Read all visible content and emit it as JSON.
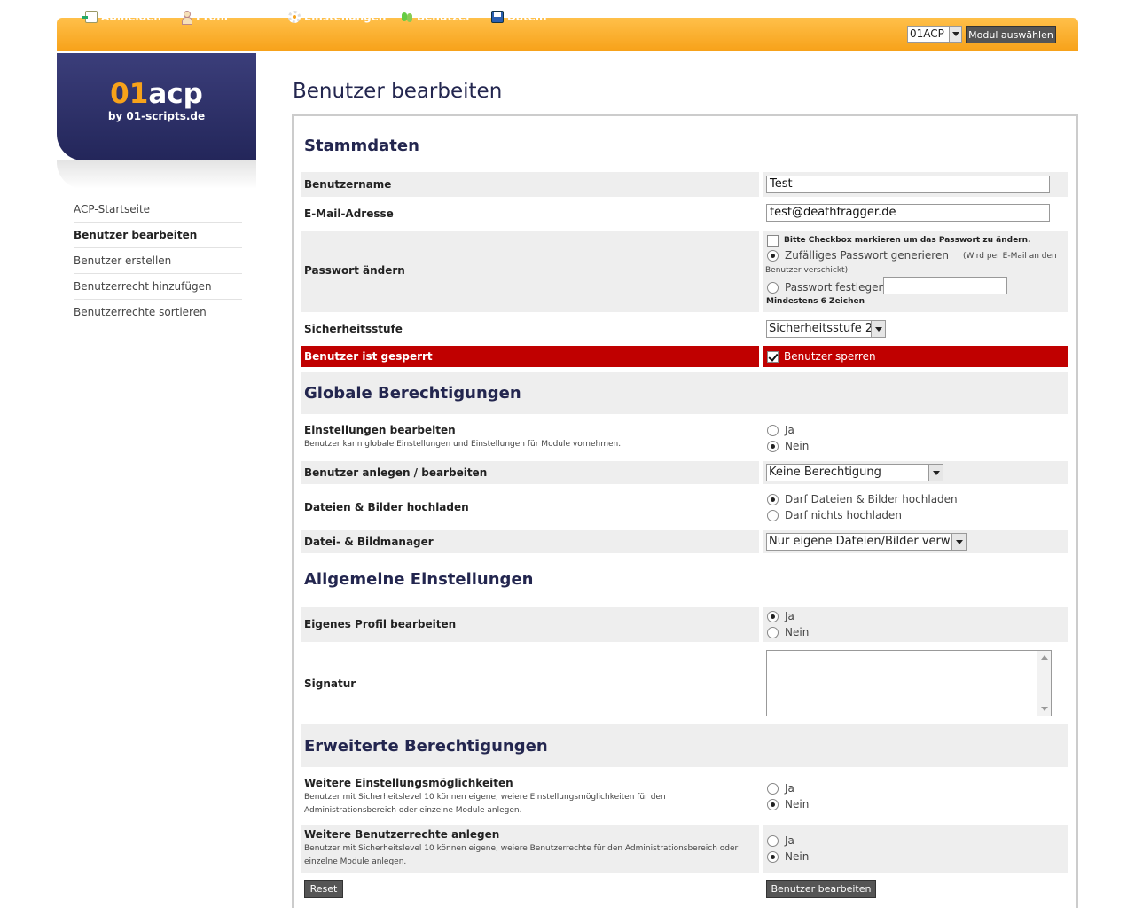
{
  "topnav": {
    "logout": "Abmelden",
    "profile": "Profil",
    "settings": "Einstellungen",
    "users": "Benutzer",
    "files": "Datein",
    "module_select_value": "01ACP",
    "module_button": "Modul auswählen"
  },
  "logo": {
    "part1": "01",
    "part2": "acp",
    "sub": "by 01-scripts.de"
  },
  "sidebar": {
    "items": [
      {
        "label": "ACP-Startseite"
      },
      {
        "label": "Benutzer bearbeiten"
      },
      {
        "label": "Benutzer erstellen"
      },
      {
        "label": "Benutzerrecht hinzufügen"
      },
      {
        "label": "Benutzerrechte sortieren"
      }
    ]
  },
  "page_title": "Benutzer bearbeiten",
  "stammdaten": {
    "heading": "Stammdaten",
    "username_label": "Benutzername",
    "username_value": "Test",
    "email_label": "E-Mail-Adresse",
    "email_value": "test@deathfragger.de",
    "password_label": "Passwort ändern",
    "password_checkbox": "Bitte Checkbox markieren um das Passwort zu ändern.",
    "password_random": "Zufälliges Passwort generieren",
    "password_random_note": "(Wird per E-Mail an den Benutzer verschickt)",
    "password_set": "Passwort festlegen:",
    "password_min": "Mindestens 6 Zeichen",
    "security_label": "Sicherheitsstufe",
    "security_value": "Sicherheitsstufe 2",
    "locked_label": "Benutzer ist gesperrt",
    "locked_checkbox": "Benutzer sperren"
  },
  "global": {
    "heading": "Globale Berechtigungen",
    "settings_label": "Einstellungen bearbeiten",
    "settings_desc": "Benutzer kann globale Einstellungen und Einstellungen für Module vornehmen.",
    "yes": "Ja",
    "no": "Nein",
    "users_label": "Benutzer anlegen / bearbeiten",
    "users_value": "Keine Berechtigung",
    "upload_label": "Dateien & Bilder hochladen",
    "upload_yes": "Darf Dateien & Bilder hochladen",
    "upload_no": "Darf nichts hochladen",
    "manager_label": "Datei- & Bildmanager",
    "manager_value": "Nur eigene Dateien/Bilder verwalten"
  },
  "general": {
    "heading": "Allgemeine Einstellungen",
    "profile_label": "Eigenes Profil bearbeiten",
    "signature_label": "Signatur"
  },
  "extended": {
    "heading": "Erweiterte Berechtigungen",
    "more_settings_label": "Weitere Einstellungsmöglichkeiten",
    "more_settings_desc": "Benutzer mit Sicherheitslevel 10 können eigene, weiere Einstellungsmöglichkeiten für den Administrationsbereich oder einzelne Module anlegen.",
    "more_rights_label": "Weitere Benutzerrechte anlegen",
    "more_rights_desc": "Benutzer mit Sicherheitslevel 10 können eigene, weiere Benutzerrechte für den Administrationsbereich oder einzelne Module anlegen."
  },
  "buttons": {
    "reset": "Reset",
    "submit": "Benutzer bearbeiten »"
  },
  "colors": {
    "accent": "#f7a21a",
    "navy": "#23264f",
    "locked_row": "#c00000"
  }
}
